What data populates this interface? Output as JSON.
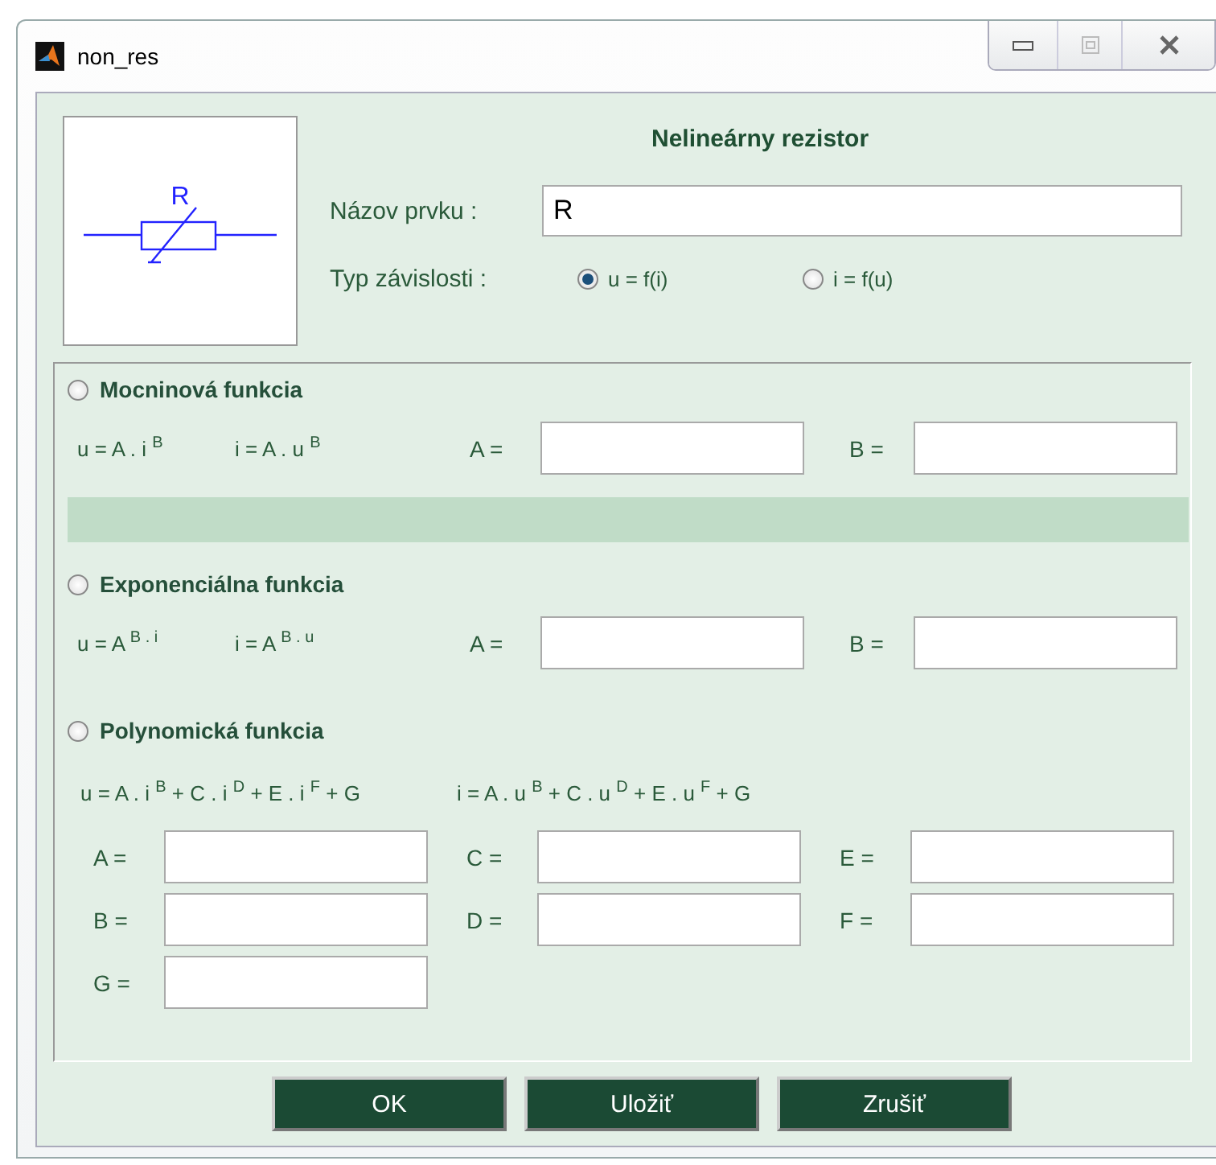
{
  "window": {
    "title": "non_res"
  },
  "preview": {
    "label": "R"
  },
  "heading": "Nelineárny rezistor",
  "name_field": {
    "label": "Názov prvku :",
    "value": "R"
  },
  "dependency": {
    "label": "Typ závislosti :",
    "options": [
      {
        "label": "u = f(i)",
        "selected": true
      },
      {
        "label": "i = f(u)",
        "selected": false
      }
    ]
  },
  "functions": [
    {
      "kind": "power",
      "label": "Mocninová funkcia",
      "selected": false,
      "formulas": [
        "u = A . i $^{B}$",
        "i = A . u $^{B}$"
      ],
      "fields": [
        {
          "label": "A ="
        },
        {
          "label": "B ="
        }
      ]
    },
    {
      "kind": "exponential",
      "label": "Exponenciálna funkcia",
      "selected": false,
      "formulas": [
        "u = A $^{B . i}$",
        "i = A $^{B . u}$"
      ],
      "fields": [
        {
          "label": "A ="
        },
        {
          "label": "B ="
        }
      ]
    },
    {
      "kind": "polynomial",
      "label": "Polynomická funkcia",
      "selected": false,
      "formulas": [
        "u = A . i $^{B}$ + C . i $^{D}$ + E . i $^{F}$ + G",
        "i = A . u $^{B}$ + C . u $^{D}$ + E . u $^{F}$ + G"
      ],
      "fields": [
        {
          "label": "A ="
        },
        {
          "label": "C ="
        },
        {
          "label": "E ="
        },
        {
          "label": "B ="
        },
        {
          "label": "D ="
        },
        {
          "label": "F ="
        },
        {
          "label": "G ="
        }
      ]
    }
  ],
  "buttons": [
    "OK",
    "Uložiť",
    "Zrušiť"
  ]
}
